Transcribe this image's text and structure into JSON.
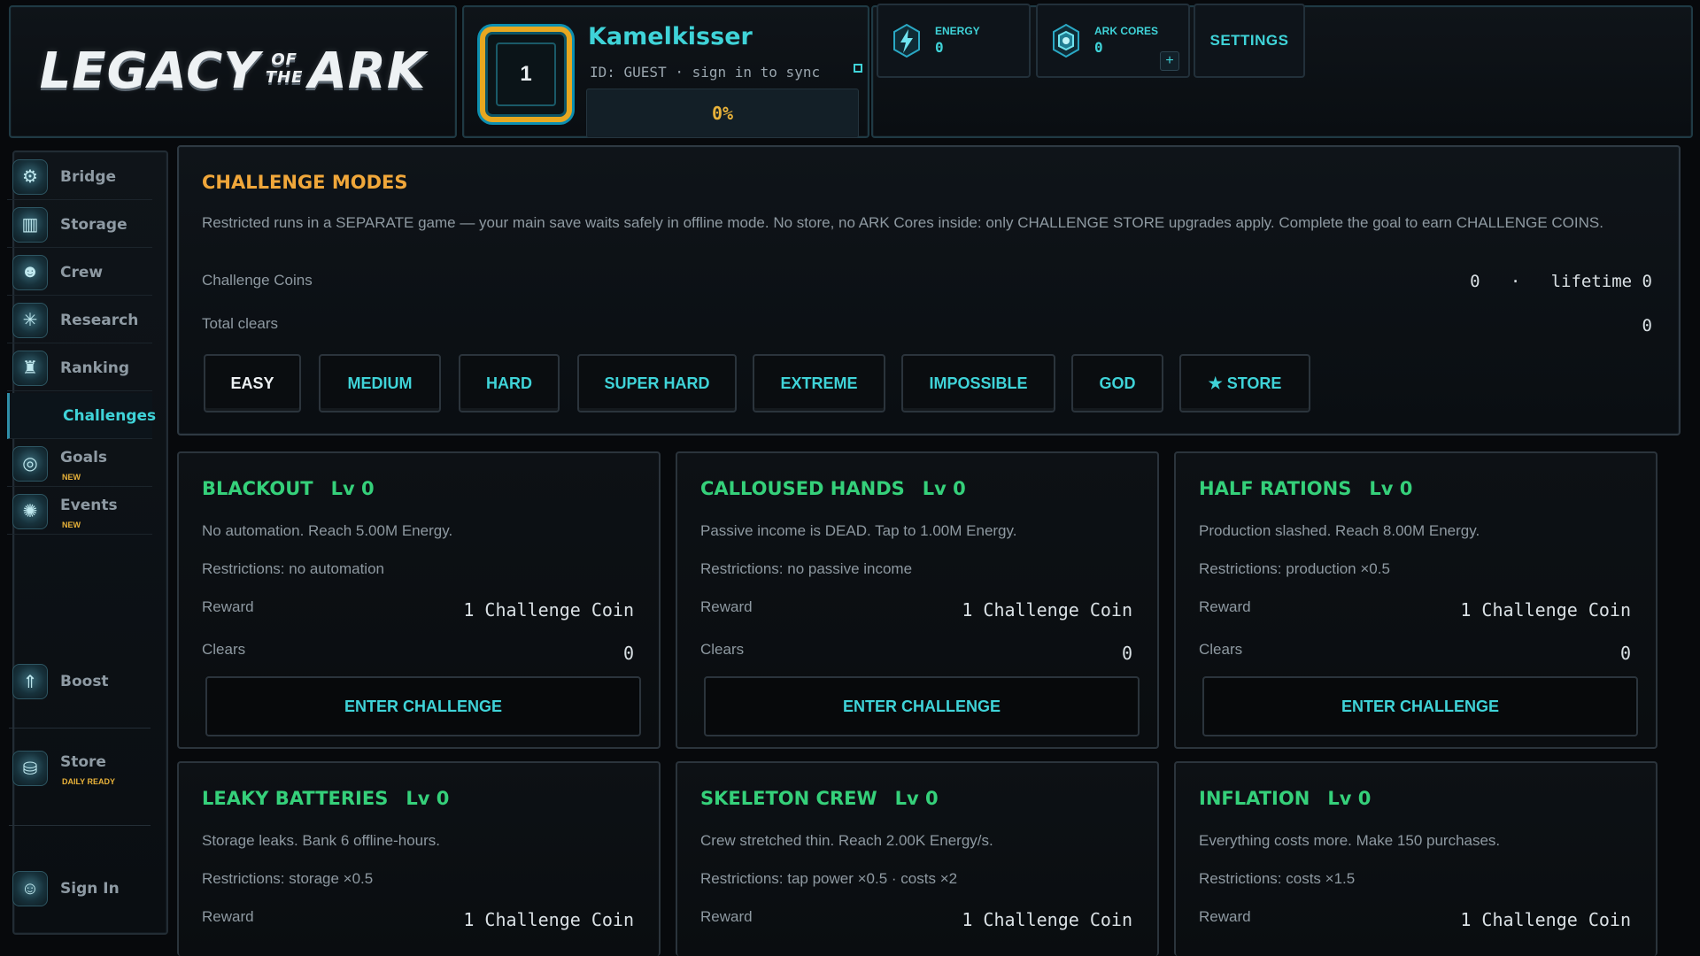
{
  "logo": {
    "left": "LEGACY",
    "of_top": "OF",
    "of_bottom": "THE",
    "right": "ARK"
  },
  "player": {
    "level": "1",
    "name": "Kamelkisser",
    "id_text": "ID: GUEST · sign in to sync",
    "progress": "0%"
  },
  "resources": {
    "energy": {
      "label": "ENERGY",
      "value": "0",
      "icon": "lightning-icon"
    },
    "ark_cores": {
      "label": "ARK CORES",
      "value": "0",
      "icon": "hex-core-icon",
      "plus": "+"
    }
  },
  "settings_label": "SETTINGS",
  "sidebar": {
    "items": [
      {
        "label": "Bridge",
        "icon": "bridge-icon"
      },
      {
        "label": "Storage",
        "icon": "storage-icon"
      },
      {
        "label": "Crew",
        "icon": "crew-icon"
      },
      {
        "label": "Research",
        "icon": "research-icon"
      },
      {
        "label": "Ranking",
        "icon": "ranking-icon"
      },
      {
        "label": "Challenges",
        "icon": "",
        "active": true
      },
      {
        "label": "Goals",
        "icon": "goals-icon",
        "sub": "NEW"
      },
      {
        "label": "Events",
        "icon": "events-icon",
        "sub": "NEW"
      },
      {
        "label": "Boost",
        "icon": "boost-icon"
      },
      {
        "label": "Store",
        "icon": "store-icon",
        "sub": "DAILY READY"
      },
      {
        "label": "Sign In",
        "icon": "sign-in-icon"
      }
    ]
  },
  "challenge_modes": {
    "title": "CHALLENGE MODES",
    "description": "Restricted runs in a SEPARATE game — your main save waits safely in offline mode. No store, no ARK Cores inside: only CHALLENGE STORE upgrades apply. Complete the goal to earn CHALLENGE COINS.",
    "coins_label": "Challenge Coins",
    "coins_value": "0   ·   lifetime 0",
    "clears_label": "Total clears",
    "clears_value": "0",
    "tabs": [
      "EASY",
      "MEDIUM",
      "HARD",
      "SUPER HARD",
      "EXTREME",
      "IMPOSSIBLE",
      "GOD",
      "★ STORE"
    ],
    "active_tab": "EASY"
  },
  "cards": [
    {
      "title": "BLACKOUT",
      "level": "Lv 0",
      "desc": "No automation. Reach 5.00M Energy.",
      "restrictions": "Restrictions: no automation",
      "reward_label": "Reward",
      "reward": "1 Challenge Coin",
      "clears_label": "Clears",
      "clears": "0",
      "button": "ENTER CHALLENGE"
    },
    {
      "title": "CALLOUSED HANDS",
      "level": "Lv 0",
      "desc": "Passive income is DEAD. Tap to 1.00M Energy.",
      "restrictions": "Restrictions: no passive income",
      "reward_label": "Reward",
      "reward": "1 Challenge Coin",
      "clears_label": "Clears",
      "clears": "0",
      "button": "ENTER CHALLENGE"
    },
    {
      "title": "HALF RATIONS",
      "level": "Lv 0",
      "desc": "Production slashed. Reach 8.00M Energy.",
      "restrictions": "Restrictions: production ×0.5",
      "reward_label": "Reward",
      "reward": "1 Challenge Coin",
      "clears_label": "Clears",
      "clears": "0",
      "button": "ENTER CHALLENGE"
    },
    {
      "title": "LEAKY BATTERIES",
      "level": "Lv 0",
      "desc": "Storage leaks. Bank 6 offline-hours.",
      "restrictions": "Restrictions: storage ×0.5",
      "reward_label": "Reward",
      "reward": "1 Challenge Coin"
    },
    {
      "title": "SKELETON CREW",
      "level": "Lv 0",
      "desc": "Crew stretched thin. Reach 2.00K Energy/s.",
      "restrictions": "Restrictions: tap power ×0.5 · costs ×2",
      "reward_label": "Reward",
      "reward": "1 Challenge Coin"
    },
    {
      "title": "INFLATION",
      "level": "Lv 0",
      "desc": "Everything costs more. Make 150 purchases.",
      "restrictions": "Restrictions: costs ×1.5",
      "reward_label": "Reward",
      "reward": "1 Challenge Coin"
    }
  ],
  "colors": {
    "accent": "#3fd3d8",
    "gold": "#e8b23a",
    "title_orange": "#f0a73a",
    "card_green": "#35d07a"
  }
}
